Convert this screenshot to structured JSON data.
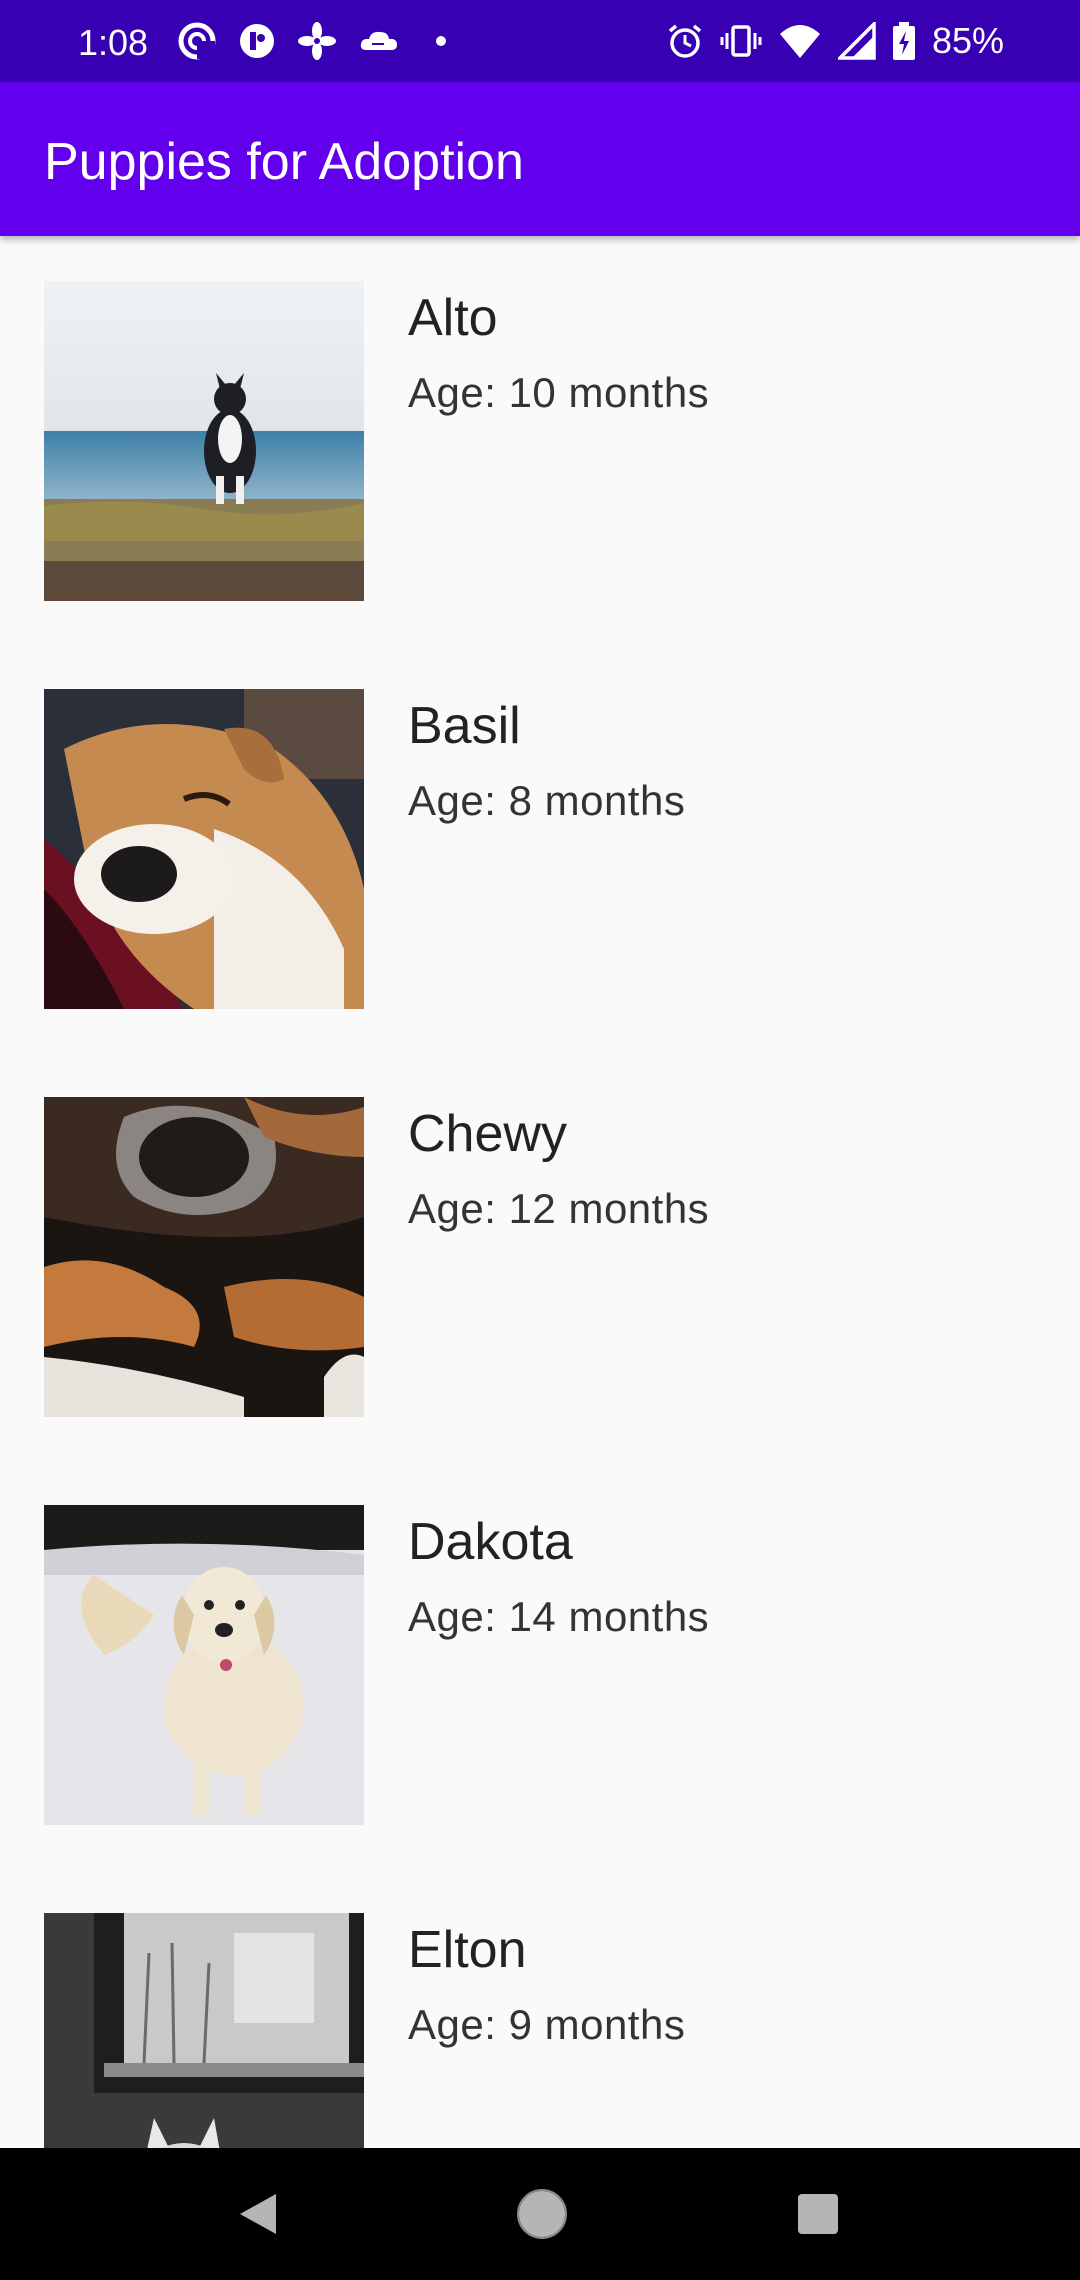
{
  "status_bar": {
    "time": "1:08",
    "battery_percent": "85%",
    "left_icons": [
      "pocket-casts-icon",
      "app-circle-icon",
      "pinwheel-icon",
      "cloud-icon",
      "dot-icon"
    ],
    "right_icons": [
      "alarm-icon",
      "vibrate-icon",
      "wifi-icon",
      "signal-icon",
      "battery-charging-icon"
    ]
  },
  "app_bar": {
    "title": "Puppies for Adoption",
    "color": "#6200ee",
    "status_color": "#3700b3"
  },
  "puppies": [
    {
      "name": "Alto",
      "age": "Age: 10 months"
    },
    {
      "name": "Basil",
      "age": "Age: 8 months"
    },
    {
      "name": "Chewy",
      "age": "Age: 12 months"
    },
    {
      "name": "Dakota",
      "age": "Age: 14 months"
    },
    {
      "name": "Elton",
      "age": "Age: 9 months"
    }
  ],
  "nav_bar": {
    "buttons": [
      "back-icon",
      "home-icon",
      "recents-icon"
    ]
  }
}
